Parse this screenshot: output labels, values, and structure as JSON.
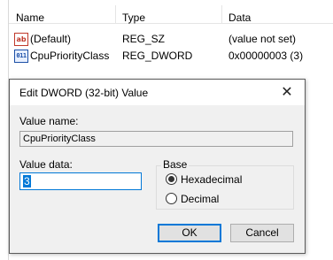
{
  "list": {
    "columns": {
      "name": "Name",
      "type": "Type",
      "data": "Data"
    },
    "rows": [
      {
        "icon": "string-value-icon",
        "icon_text": "ab",
        "name": "(Default)",
        "type": "REG_SZ",
        "data": "(value not set)"
      },
      {
        "icon": "binary-value-icon",
        "icon_text": "011",
        "name": "CpuPriorityClass",
        "type": "REG_DWORD",
        "data": "0x00000003 (3)"
      }
    ]
  },
  "dialog": {
    "title": "Edit DWORD (32-bit) Value",
    "close_glyph": "✕",
    "value_name_label": "Value name:",
    "value_name": "CpuPriorityClass",
    "value_data_label": "Value data:",
    "value_data": "3",
    "base_label": "Base",
    "base_options": [
      {
        "label": "Hexadecimal",
        "selected": true
      },
      {
        "label": "Decimal",
        "selected": false
      }
    ],
    "ok_label": "OK",
    "cancel_label": "Cancel",
    "accent_color": "#0078d7"
  }
}
